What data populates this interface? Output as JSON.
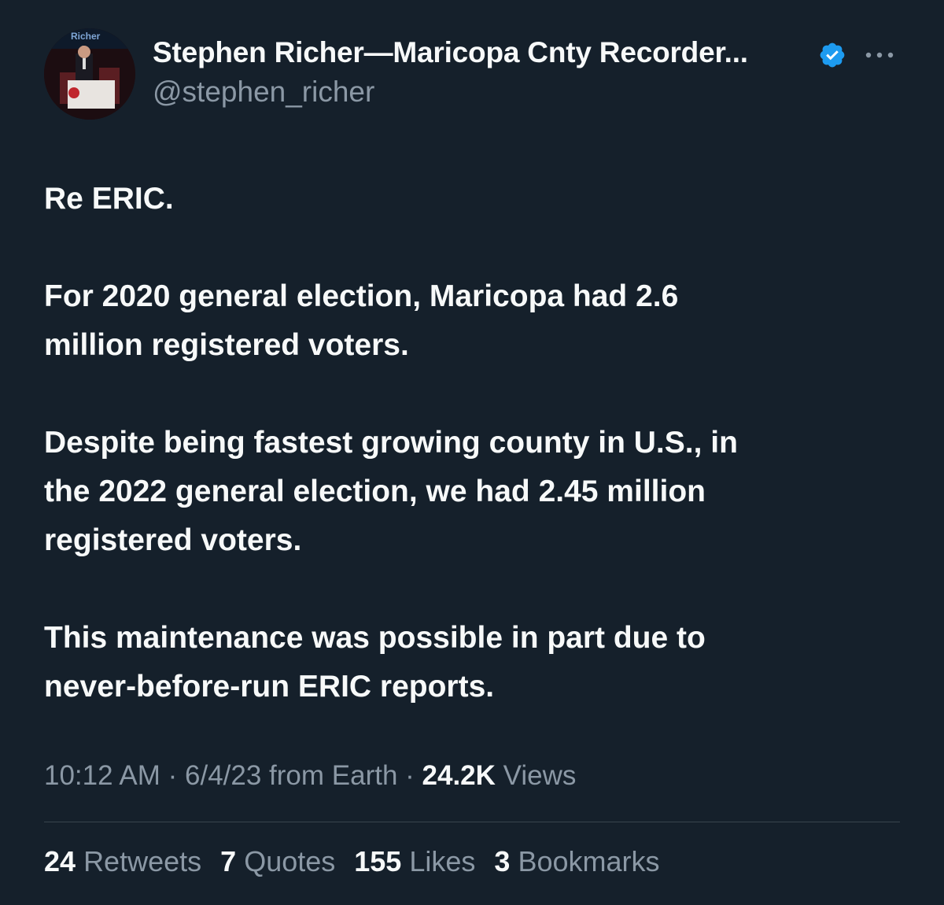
{
  "author": {
    "display_name": "Stephen Richer—Maricopa Cnty Recorder...",
    "handle": "@stephen_richer",
    "avatar_banner_text": "Richer"
  },
  "icons": {
    "verified": "verified-badge-icon",
    "more": "more-options-icon",
    "verified_color": "#1d9bf0"
  },
  "tweet": {
    "paragraphs": [
      "Re ERIC.",
      "For 2020 general election, Maricopa had 2.6\nmillion registered voters.",
      "Despite being fastest growing county in U.S., in\nthe 2022 general election, we had 2.45 million\nregistered voters.",
      "This maintenance was possible in part due to\nnever-before-run ERIC reports."
    ]
  },
  "meta": {
    "time": "10:12 AM",
    "sep1": " · ",
    "date": "6/4/23",
    "source": " from Earth",
    "sep2": " · ",
    "views_count": "24.2K",
    "views_label": " Views"
  },
  "stats": [
    {
      "count": "24",
      "label": "Retweets"
    },
    {
      "count": "7",
      "label": "Quotes"
    },
    {
      "count": "155",
      "label": "Likes"
    },
    {
      "count": "3",
      "label": "Bookmarks"
    }
  ]
}
